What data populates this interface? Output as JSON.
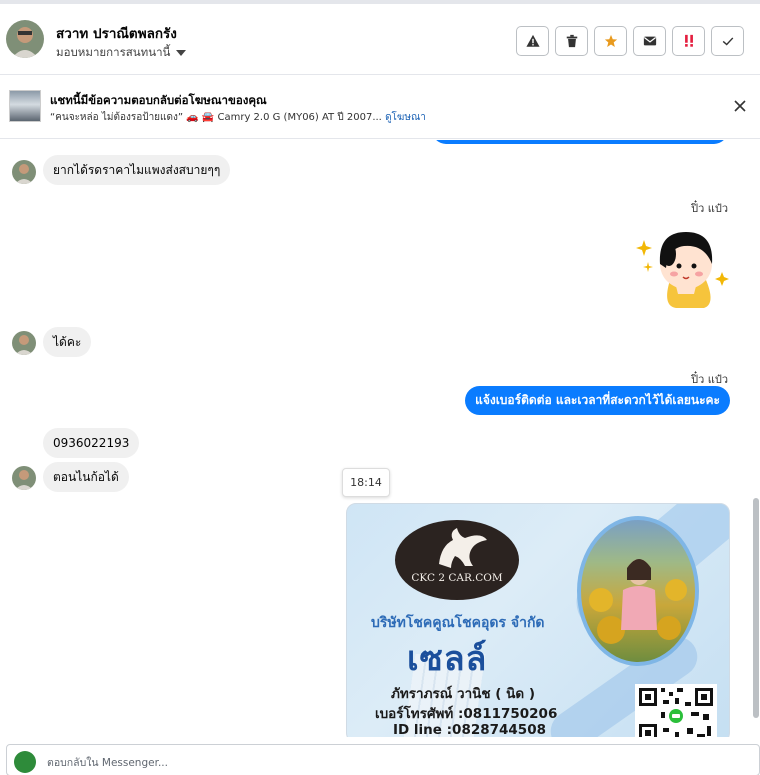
{
  "header": {
    "contact_name": "สวาท ปราณีตพลกรัง",
    "assign_label": "มอบหมายการสนทนานี้",
    "action_icons": [
      "warning-icon",
      "trash-icon",
      "star-icon",
      "envelope-icon",
      "important-icon",
      "check-icon"
    ],
    "colors": {
      "star": "#e89a1e",
      "important": "#e41e3f"
    }
  },
  "ad_banner": {
    "title": "แชทนี้มีข้อความตอบกลับต่อโฆษณาของคุณ",
    "quote": "“คนจะหล่อ ไม่ต้องรอป้ายแดง” 🚗 🚘 Camry 2.0 G (MY06) AT ปี 2007...",
    "link": "ดูโฆษณา"
  },
  "messages": {
    "m1": "ยากได้รดราคาไมแพงส่งสบายๆๆ",
    "sender_a": "ปิ๋ว แป๋ว",
    "m2": "ได้คะ",
    "sender_b": "ปิ๋ว แป๋ว",
    "m3": "แจ้งเบอร์ติดต่อ  และเวลาที่สะดวกไว้ได้เลยนะคะ",
    "m4": "0936022193",
    "m5": "ตอนไนก้อได้",
    "time_tooltip": "18:14"
  },
  "card": {
    "logo_text": "CKC 2 CAR.COM",
    "company": "บริษัทโชคคูณโชคอุดร จำกัด",
    "role": "เซลล์",
    "person": "ภัทราภรณ์  วานิช ( นิด )",
    "phone": "เบอร์โทรศัพท์ :0811750206",
    "line_id": "ID line :0828744508"
  },
  "composer": {
    "placeholder": "ตอบกลับใน Messenger..."
  },
  "colors": {
    "accent": "#0a7cff",
    "incoming_bubble": "#f0f0f0"
  }
}
